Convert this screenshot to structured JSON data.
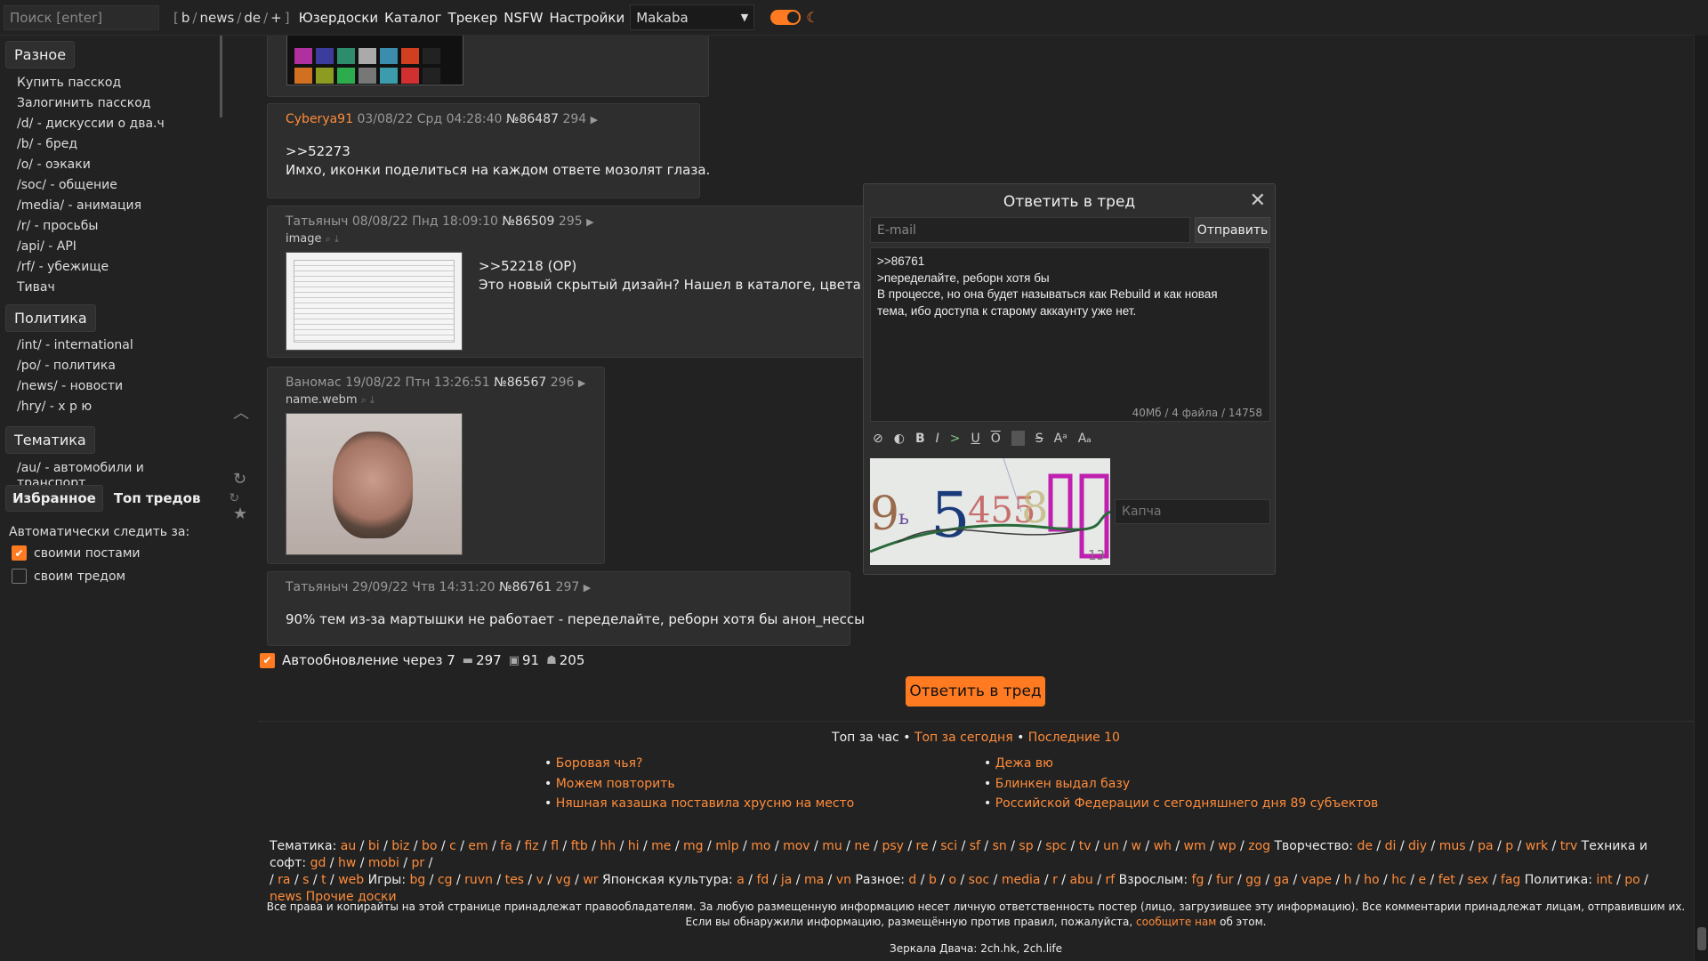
{
  "topbar": {
    "search_placeholder": "Поиск [enter]",
    "boards": [
      "b",
      "news",
      "de",
      "+"
    ],
    "links": [
      "Юзердоски",
      "Каталог",
      "Трекер",
      "NSFW",
      "Настройки"
    ],
    "style_select": "Makaba",
    "theme_toggle": "dark"
  },
  "sidebar": {
    "section1": {
      "title": "Разное",
      "items": [
        "Купить пасскод",
        "Залогинить пасскод",
        "/d/ - дискуссии о два.ч",
        "/b/ - бред",
        "/o/ - оэкаки",
        "/soc/ - общение",
        "/media/ - анимация",
        "/r/ - просьбы",
        "/api/ - API",
        "/rf/ - убежище",
        "Тивач"
      ]
    },
    "section2": {
      "title": "Политика",
      "items": [
        "/int/ - international",
        "/po/ - политика",
        "/news/ - новости",
        "/hry/ - х р ю"
      ]
    },
    "section3": {
      "title": "Тематика",
      "items": [
        "/au/ - автомобили и транспорт"
      ]
    },
    "fav_tab": "Избранное",
    "top_tab": "Топ тредов",
    "auto_follow_label": "Автоматически следить за:",
    "cb_posts": "своими постами",
    "cb_posts_checked": true,
    "cb_thread": "своим тредом",
    "cb_thread_checked": false
  },
  "posts": [
    {
      "name": "Cyberya91",
      "date": "03/08/22 Срд 04:28:40",
      "num": "№86487",
      "idx": "294",
      "reply": ">>52273",
      "text": "Имхо, иконки поделиться на каждом ответе мозолят глаза."
    },
    {
      "name": "Татьяныч",
      "date": "08/08/22 Пнд 18:09:10",
      "num": "№86509",
      "idx": "295",
      "file": "image",
      "reply": ">>52218 (OP)",
      "text": "Это новый скрытый дизайн? Нашел в каталоге, цвета дру"
    },
    {
      "name": "Ваномас",
      "date": "19/08/22 Птн 13:26:51",
      "num": "№86567",
      "idx": "296",
      "file": "name.webm"
    },
    {
      "name": "Татьяныч",
      "date": "29/09/22 Чтв 14:31:20",
      "num": "№86761",
      "idx": "297",
      "text": "90% тем из-за мартышки не работает - переделайте, реборн хотя бы анон_нессы"
    }
  ],
  "reply_form": {
    "title": "Ответить в тред",
    "email_placeholder": "E-mail",
    "send": "Отправить",
    "comment": ">>86761\n>переделайте, реборн хотя бы\nВ процессе, но она будет называться как Rebuild и как новая\nтема, ибо доступа к старому аккаунту уже нет.",
    "counter": "40Мб / 4 файла / 14758",
    "captcha_placeholder": "Капча",
    "captcha_number": "13"
  },
  "thread_stats": {
    "autoupdate": "Автообновление через 7",
    "posts": "297",
    "images": "91",
    "users": "205"
  },
  "reply_button": "Ответить в тред",
  "top": {
    "tab_hour": "Топ за час",
    "tab_today": "Топ за сегодня",
    "tab_last": "Последние 10",
    "left": [
      "Боровая чья?",
      "Можем повторить",
      "Няшная казашка поставила хрусню на место"
    ],
    "right": [
      "Дежа вю",
      "Блинкен выдал базу",
      "Российской Федерации с сегодняшнего дня 89 субъектов"
    ]
  },
  "boards_footer": {
    "line1": [
      {
        "cat": "Тематика:",
        "boards": [
          "au",
          "bi",
          "biz",
          "bo",
          "c",
          "em",
          "fa",
          "fiz",
          "fl",
          "ftb",
          "hh",
          "hi",
          "me",
          "mg",
          "mlp",
          "mo",
          "mov",
          "mu",
          "ne",
          "psy",
          "re",
          "sci",
          "sf",
          "sn",
          "sp",
          "spc",
          "tv",
          "un",
          "w",
          "wh",
          "wm",
          "wp",
          "zog"
        ]
      },
      {
        "cat": "Творчество:",
        "boards": [
          "de",
          "di",
          "diy",
          "mus",
          "pa",
          "p",
          "wrk",
          "trv"
        ]
      },
      {
        "cat": "Техника и софт:",
        "boards": [
          "gd",
          "hw",
          "mobi",
          "pr"
        ]
      }
    ],
    "line2": [
      {
        "cat": "",
        "boards": [
          "ra",
          "s",
          "t",
          "web"
        ]
      },
      {
        "cat": "Игры:",
        "boards": [
          "bg",
          "cg",
          "ruvn",
          "tes",
          "v",
          "vg",
          "wr"
        ]
      },
      {
        "cat": "Японская культура:",
        "boards": [
          "a",
          "fd",
          "ja",
          "ma",
          "vn"
        ]
      },
      {
        "cat": "Разное:",
        "boards": [
          "d",
          "b",
          "o",
          "soc",
          "media",
          "r",
          "abu",
          "rf"
        ]
      },
      {
        "cat": "Взрослым:",
        "boards": [
          "fg",
          "fur",
          "gg",
          "ga",
          "vape",
          "h",
          "ho",
          "hc",
          "e",
          "fet",
          "sex",
          "fag"
        ]
      },
      {
        "cat": "Политика:",
        "boards": [
          "int",
          "po",
          "news"
        ]
      }
    ],
    "other": "Прочие доски"
  },
  "copyright": {
    "line1": "Все права и копирайты на этой странице принадлежат правообладателям. За любую размещенную информацию несет личную ответственность постер (лицо, загрузившее эту информацию). Все комментарии принадлежат лицам, отправившим их.",
    "line2_pre": "Если вы обнаружили информацию, размещённую против правил, пожалуйста,",
    "line2_link": "сообщите нам",
    "line2_post": "об этом."
  },
  "mirrors": "Зеркала Двача: 2ch.hk, 2ch.life",
  "colors": {
    "accent": "#ff7a21",
    "bg": "#222222",
    "post_bg": "#2e2e2e"
  }
}
